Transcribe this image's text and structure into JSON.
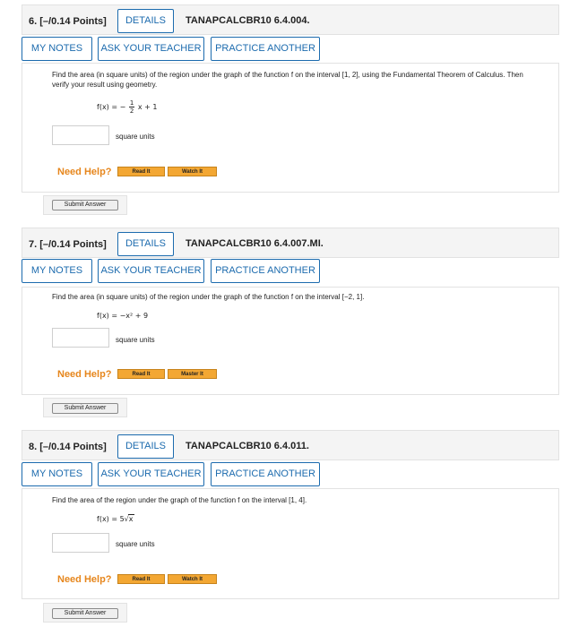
{
  "questions": [
    {
      "number": "6.",
      "points": "[–/0.14 Points]",
      "details": "DETAILS",
      "code": "TANAPCALCBR10 6.4.004.",
      "my_notes": "MY NOTES",
      "ask_teacher": "ASK YOUR TEACHER",
      "practice": "PRACTICE ANOTHER",
      "prompt": "Find the area (in square units) of the region under the graph of the function f on the interval [1, 2], using the Fundamental Theorem of Calculus. Then verify your result using geometry.",
      "function_lhs": "f(x) = −",
      "frac_num": "1",
      "frac_den": "2",
      "function_rhs": "x + 1",
      "units": "square units",
      "need_help": "Need Help?",
      "help1": "Read It",
      "help2": "Watch It",
      "submit": "Submit Answer"
    },
    {
      "number": "7.",
      "points": "[–/0.14 Points]",
      "details": "DETAILS",
      "code": "TANAPCALCBR10 6.4.007.MI.",
      "my_notes": "MY NOTES",
      "ask_teacher": "ASK YOUR TEACHER",
      "practice": "PRACTICE ANOTHER",
      "prompt": "Find the area (in square units) of the region under the graph of the function f on the interval [−2, 1].",
      "function": "f(x) = −x² + 9",
      "units": "square units",
      "need_help": "Need Help?",
      "help1": "Read It",
      "help2": "Master It",
      "submit": "Submit Answer"
    },
    {
      "number": "8.",
      "points": "[–/0.14 Points]",
      "details": "DETAILS",
      "code": "TANAPCALCBR10 6.4.011.",
      "my_notes": "MY NOTES",
      "ask_teacher": "ASK YOUR TEACHER",
      "practice": "PRACTICE ANOTHER",
      "prompt": "Find the area of the region under the graph of the function f on the interval [1, 4].",
      "function_lhs": "f(x) = 5",
      "function_radicand": "x",
      "units": "square units",
      "need_help": "Need Help?",
      "help1": "Read It",
      "help2": "Watch It",
      "submit": "Submit Answer"
    }
  ]
}
